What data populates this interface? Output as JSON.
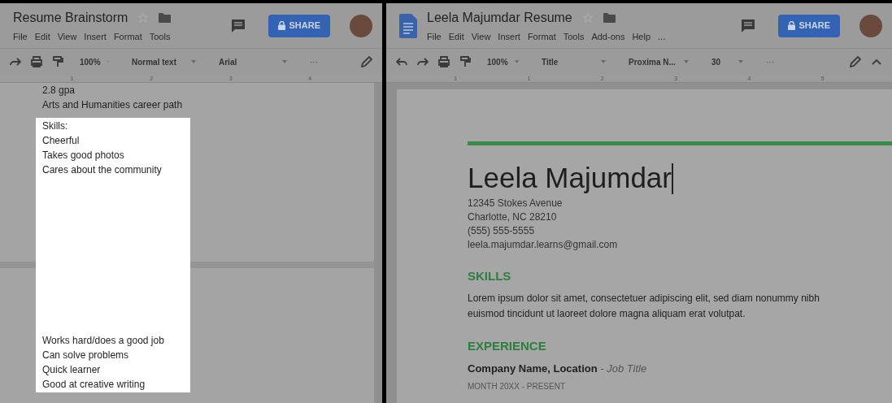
{
  "left_window": {
    "title": "Resume Brainstorm",
    "menu": [
      "File",
      "Edit",
      "View",
      "Insert",
      "Format",
      "Tools"
    ],
    "share": "SHARE",
    "toolbar": {
      "zoom": "100%",
      "style": "Normal text",
      "font": "Arial",
      "more": "···"
    },
    "ruler": [
      "1",
      "2",
      "3",
      "4"
    ],
    "document": {
      "lines": [
        "2.8 gpa",
        "Arts and Humanities career path"
      ],
      "highlight_top": [
        "Skills:",
        "Cheerful",
        "Takes good photos",
        "Cares about the community"
      ],
      "highlight_bottom": [
        "Works hard/does a good job",
        "Can solve problems",
        "Quick learner",
        "Good at creative writing"
      ]
    }
  },
  "right_window": {
    "title": "Leela Majumdar Resume",
    "menu": [
      "File",
      "Edit",
      "View",
      "Insert",
      "Format",
      "Tools",
      "Add-ons",
      "Help",
      "..."
    ],
    "share": "SHARE",
    "toolbar": {
      "zoom": "100%",
      "style": "Title",
      "font": "Proxima N...",
      "size": "30",
      "more": "···"
    },
    "ruler": [
      "1",
      "1",
      "2",
      "3",
      "4",
      "5"
    ],
    "document": {
      "name": "Leela Majumdar",
      "contact": [
        "12345 Stokes Avenue",
        "Charlotte, NC 28210",
        "(555) 555-5555",
        "leela.majumdar.learns@gmail.com"
      ],
      "sections": [
        {
          "heading": "SKILLS",
          "kind": "paragraph",
          "text": "Lorem ipsum dolor sit amet, consectetuer adipiscing elit, sed diam nonummy nibh euismod tincidunt ut laoreet dolore magna aliquam erat volutpat."
        },
        {
          "heading": "EXPERIENCE",
          "kind": "job",
          "company": "Company Name,  Location",
          "role": "- Job Title",
          "dates": "MONTH 20XX - PRESENT"
        }
      ]
    }
  }
}
